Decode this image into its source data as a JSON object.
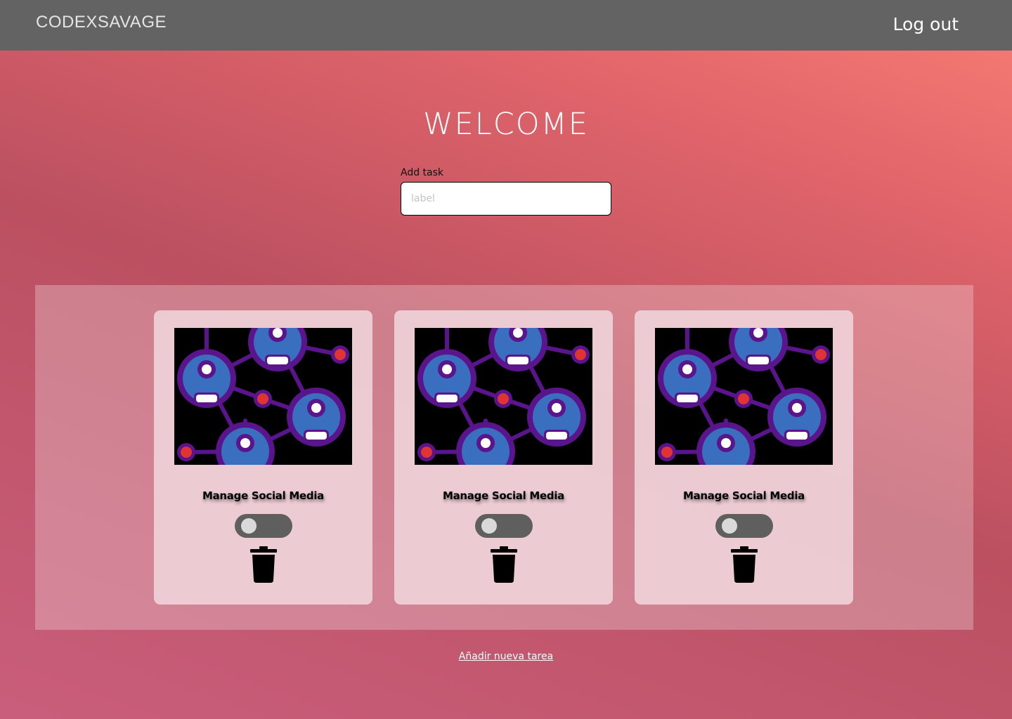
{
  "header": {
    "brand": "CODEXSAVAGE",
    "logout_label": "Log out"
  },
  "main": {
    "title": "WELCOME",
    "add_task": {
      "label": "Add task",
      "placeholder": "label",
      "value": ""
    }
  },
  "tasks": [
    {
      "title": "Manage Social Media",
      "completed": false,
      "image_icon": "social-network-icon",
      "delete_icon": "trash-icon"
    },
    {
      "title": "Manage Social Media",
      "completed": false,
      "image_icon": "social-network-icon",
      "delete_icon": "trash-icon"
    },
    {
      "title": "Manage Social Media",
      "completed": false,
      "image_icon": "social-network-icon",
      "delete_icon": "trash-icon"
    }
  ],
  "footer": {
    "add_new_label": "Añadir nueva tarea"
  },
  "colors": {
    "topbar": "#636363",
    "gradient_light": "#f87d74",
    "gradient_dark": "#bb5061",
    "toggle_track": "#5f5f5f",
    "toggle_knob": "#d9d9d9",
    "network_node_blue": "#3a6fbf",
    "network_ring_purple": "#5a148c",
    "network_dot_red": "#e03434"
  }
}
